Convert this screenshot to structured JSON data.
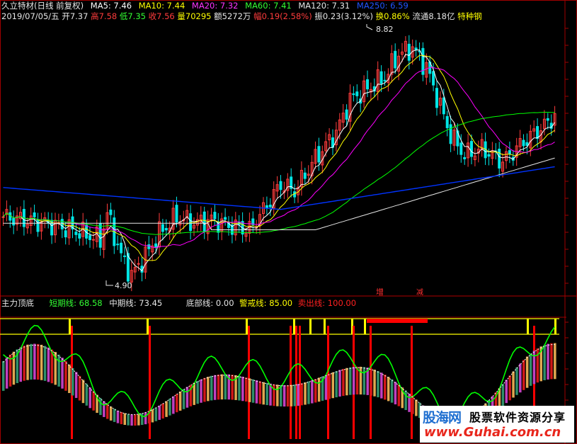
{
  "header": {
    "stock_name": "久立特材",
    "period": "(日线 前复权)",
    "ma5": "MA5: 7.46",
    "ma10": "MA10: 7.44",
    "ma20": "MA20: 7.32",
    "ma60": "MA60: 7.41",
    "ma120": "MA120: 7.31",
    "ma250": "MA250: 6.59",
    "date": "2019/07/05/五",
    "open": "开7.37",
    "high": "高7.58",
    "low": "低7.35",
    "close": "收7.56",
    "volume": "量70295",
    "amount": "额5272万",
    "change": "幅0.19(2.58%)",
    "amplitude": "振0.23(3.12%)",
    "turnover": "换0.86%",
    "float": "流通8.18亿",
    "sector": "特种钢"
  },
  "annotations": {
    "max_label": "8.82",
    "min_label": "4.90",
    "mark_add": "增",
    "mark_reduce": "减"
  },
  "indicator": {
    "name": "主力顶底",
    "short_line": "短期线: 68.58",
    "mid_line": "中期线: 73.45",
    "bottom_line": "底部线: 0.00",
    "alert_line": "警戒线: 85.00",
    "sell_line": "卖出线: 100.00"
  },
  "watermark": {
    "brand": "股海网",
    "slogan": "股票软件资源分享",
    "url": "www.Guhai.com.cn"
  },
  "colors": {
    "up": "#ff3c3c",
    "down": "#00e5e5",
    "ma5": "#ffffff",
    "ma10": "#ffff00",
    "ma20": "#ff00ff",
    "ma60": "#00ff00",
    "ma120": "#e6e6e6",
    "ma250": "#0033ff",
    "short_line": "#00ff00",
    "mid_line": "#ffffff",
    "alert_line": "#ffff00",
    "sell_line": "#ff0000"
  }
}
